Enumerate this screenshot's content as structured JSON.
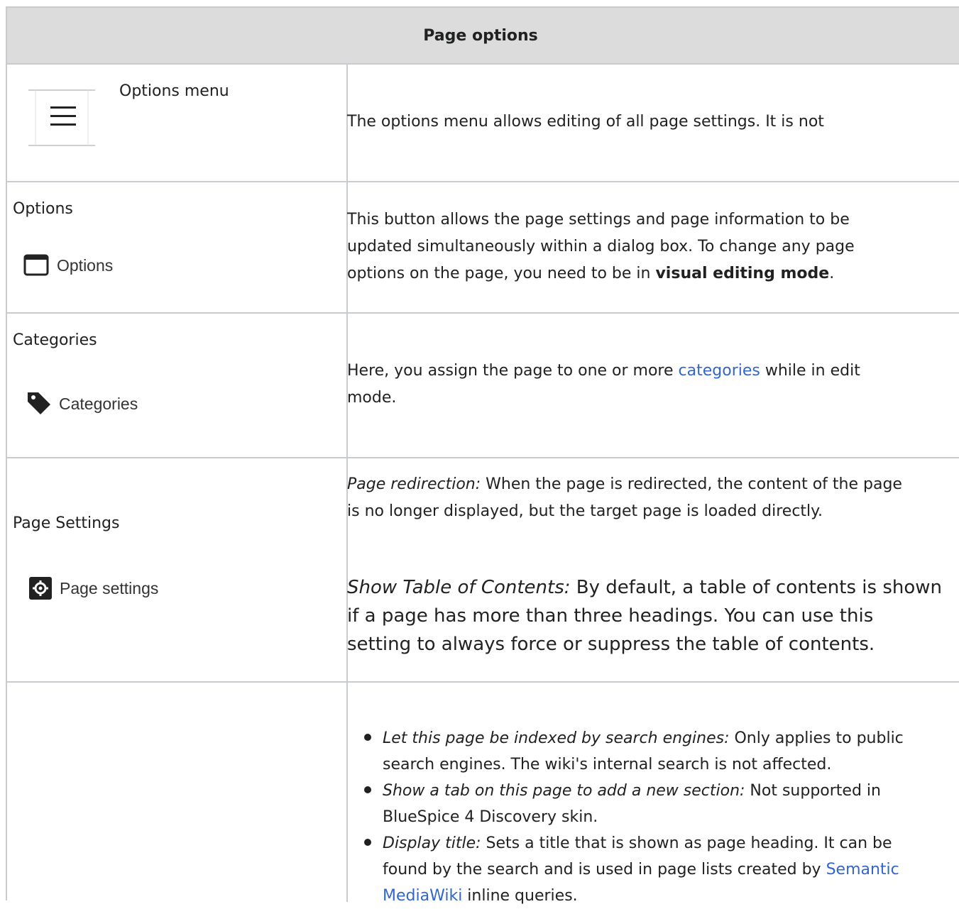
{
  "header": {
    "title": "Page options"
  },
  "rows": {
    "options_menu": {
      "label": "Options menu",
      "desc": "The options menu allows editing of all page settings. It is not"
    },
    "options": {
      "label": "Options",
      "button_label": "Options",
      "desc_line1": "This button allows the page settings and page information to be",
      "desc_line2": "updated simultaneously within a dialog box. To change any page",
      "desc_line3_pre": "options on the page, you need to be in ",
      "desc_line3_bold": "visual editing mode",
      "desc_line3_post": "."
    },
    "categories": {
      "label": "Categories",
      "button_label": "Categories",
      "desc_pre": "Here, you assign the page to one or more ",
      "desc_link": "categories",
      "desc_post": " while in edit",
      "desc_line2": "mode."
    },
    "page_settings": {
      "label": "Page Settings",
      "button_label": "Page settings",
      "redir_title": "Page redirection:",
      "redir_line1": " When the page is redirected, the content of the page",
      "redir_line2": "is no longer displayed, but the target page is loaded directly.",
      "toc_title": "Show Table of Contents:",
      "toc_line1": " By default, a table of contents is shown",
      "toc_line2": "if a page has more than three headings. You can use this",
      "toc_line3": "setting to always force or suppress the table of contents."
    },
    "list": {
      "item1_title": "Let this page be indexed by search engines:",
      "item1_line1": " Only applies to public",
      "item1_line2": "search engines. The wiki's internal search is not affected.",
      "item2_title": "Show a tab on this page to add a new section:",
      "item2_line1": " Not supported in",
      "item2_line2": "BlueSpice 4 Discovery skin.",
      "item3_title": "Display title:",
      "item3_line1": " Sets a title that is shown as page heading. It can be",
      "item3_line2_pre": "found by the search and is used in page lists created by ",
      "item3_line2_link": "Semantic",
      "item3_line3_link": "MediaWiki",
      "item3_line3_post": " inline queries."
    }
  },
  "icons": [
    "menu-icon",
    "window-icon",
    "tag-icon",
    "gear-icon"
  ],
  "colors": {
    "header_bg": "#dcdcdc",
    "border": "#c8ccd1",
    "link": "#3366cc"
  }
}
